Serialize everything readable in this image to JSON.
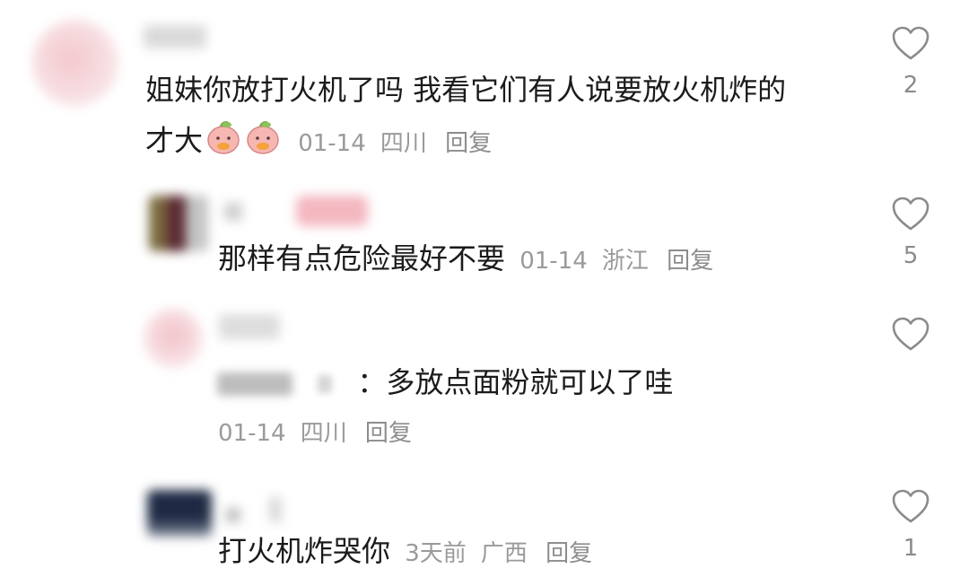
{
  "comments": [
    {
      "text": "姐妹你放打火机了吗 我看它们有人说要放火机炸的",
      "text_cont": "才大",
      "emoji": "peach-face-emoji",
      "date": "01-14",
      "location": "四川",
      "reply_label": "回复",
      "likes": "2"
    },
    {
      "text": "那样有点危险最好不要",
      "date": "01-14",
      "location": "浙江",
      "reply_label": "回复",
      "likes": "5"
    },
    {
      "text": "：多放点面粉就可以了哇",
      "date": "01-14",
      "location": "四川",
      "reply_label": "回复"
    },
    {
      "text": "打火机炸哭你",
      "date": "3天前",
      "location": "广西",
      "reply_label": "回复",
      "likes": "1"
    }
  ],
  "icons": {
    "like": "heart-outline-icon"
  },
  "colors": {
    "text": "#1b1b1b",
    "meta": "#9a9a9a",
    "icon": "#8b8b8b"
  }
}
